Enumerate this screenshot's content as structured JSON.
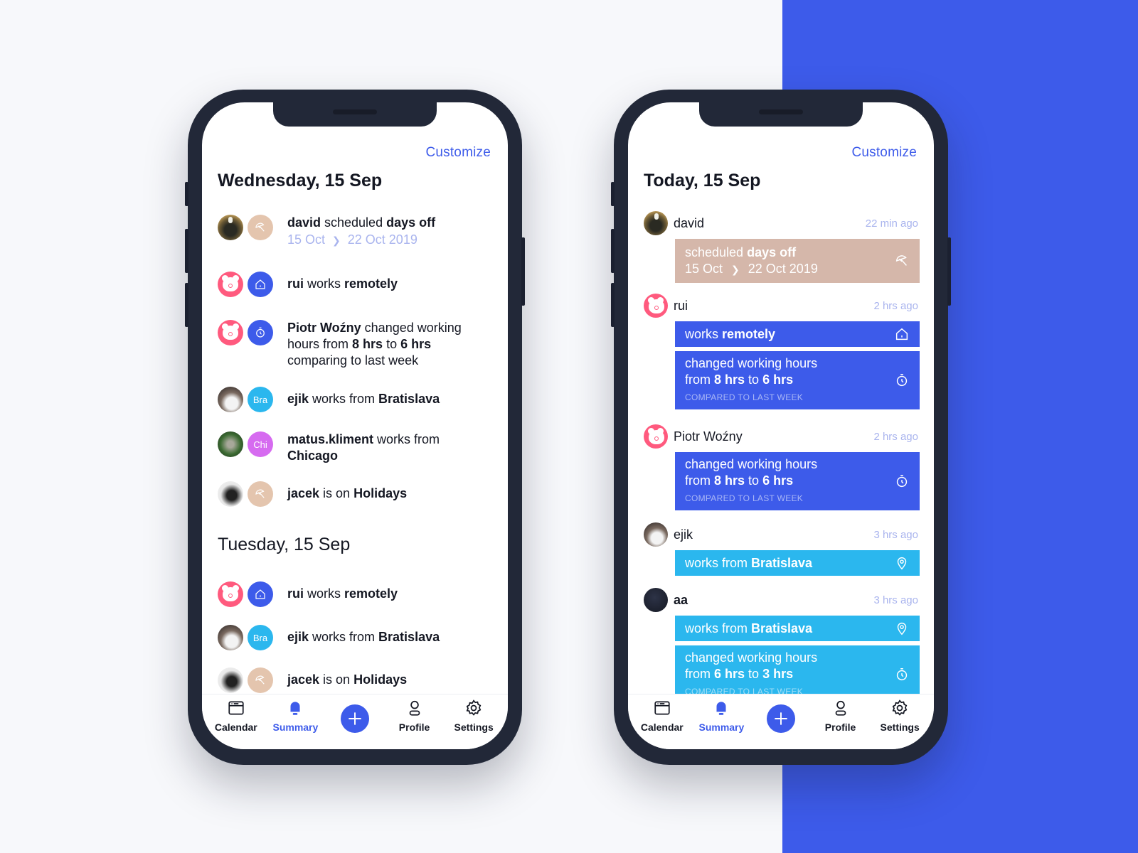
{
  "theme": {
    "accent": "#3d5bea",
    "cyan": "#2bb7ee",
    "beige": "#e4c5ae",
    "card_beige": "#d5b7aa",
    "purple": "#d66bf0",
    "pink": "#ff5a7e",
    "muted_blue": "#a9b4ee"
  },
  "left_phone": {
    "customize_label": "Customize",
    "sections": [
      {
        "title": "Wednesday, 15 Sep",
        "items": [
          {
            "user": "david",
            "badge_icon": "umbrella-icon",
            "parts": [
              "david",
              " scheduled ",
              "days off"
            ],
            "dates": {
              "from": "15 Oct",
              "to": "22 Oct 2019"
            }
          },
          {
            "user": "rui",
            "badge_icon": "home-icon",
            "parts": [
              "rui",
              " works ",
              "remotely"
            ]
          },
          {
            "user": "Piotr Woźny",
            "badge_icon": "stopwatch-icon",
            "parts": [
              "Piotr Woźny",
              " changed working hours from ",
              "8 hrs",
              " to ",
              "6 hrs",
              " comparing to last week"
            ]
          },
          {
            "user": "ejik",
            "badge_text": "Bra",
            "parts": [
              "ejik",
              " works from ",
              "Bratislava"
            ]
          },
          {
            "user": "matus.kliment",
            "badge_text": "Chi",
            "parts": [
              "matus.kliment",
              " works from ",
              "Chicago"
            ]
          },
          {
            "user": "jacek",
            "badge_icon": "umbrella-icon",
            "parts": [
              "jacek",
              " is on ",
              "Holidays"
            ]
          }
        ]
      },
      {
        "title": "Tuesday, 15 Sep",
        "items": [
          {
            "user": "rui",
            "badge_icon": "home-icon",
            "parts": [
              "rui",
              " works ",
              "remotely"
            ]
          },
          {
            "user": "ejik",
            "badge_text": "Bra",
            "parts": [
              "ejik",
              " works from ",
              "Bratislava"
            ]
          },
          {
            "user": "jacek",
            "badge_icon": "umbrella-icon",
            "parts": [
              "jacek",
              " is on ",
              "Holidays"
            ]
          }
        ]
      }
    ]
  },
  "right_phone": {
    "customize_label": "Customize",
    "title": "Today, 15 Sep",
    "entries": [
      {
        "user": "david",
        "time": "22 min ago",
        "cards": [
          {
            "color": "beige",
            "icon": "umbrella-icon",
            "parts": [
              "scheduled ",
              "days off"
            ],
            "dates": {
              "from": "15 Oct",
              "to": "22 Oct 2019"
            }
          }
        ]
      },
      {
        "user": "rui",
        "time": "2 hrs ago",
        "cards": [
          {
            "color": "blue",
            "icon": "home-icon",
            "parts": [
              "works ",
              "remotely"
            ]
          },
          {
            "color": "blue",
            "icon": "stopwatch-icon",
            "line1": "changed working hours",
            "parts": [
              "from ",
              "8 hrs",
              " to ",
              "6 hrs"
            ],
            "sub": "COMPARED TO LAST WEEK"
          }
        ]
      },
      {
        "user": "Piotr Woźny",
        "time": "2 hrs ago",
        "cards": [
          {
            "color": "blue",
            "icon": "stopwatch-icon",
            "line1": "changed working hours",
            "parts": [
              "from ",
              "8 hrs",
              " to ",
              "6 hrs"
            ],
            "sub": "COMPARED TO LAST WEEK"
          }
        ]
      },
      {
        "user": "ejik",
        "time": "3 hrs ago",
        "cards": [
          {
            "color": "cyan",
            "icon": "location-pin-icon",
            "parts": [
              "works from ",
              "Bratislava"
            ]
          }
        ]
      },
      {
        "user": "aa",
        "time": "3 hrs ago",
        "cards": [
          {
            "color": "cyan",
            "icon": "location-pin-icon",
            "parts": [
              "works from ",
              "Bratislava"
            ]
          },
          {
            "color": "cyan",
            "icon": "stopwatch-icon",
            "line1": "changed working hours",
            "parts": [
              "from ",
              "6 hrs",
              " to ",
              "3 hrs"
            ],
            "sub": "COMPARED TO LAST WEEK"
          }
        ]
      }
    ]
  },
  "tabbar": {
    "tabs": [
      {
        "label": "Calendar",
        "icon": "calendar-icon",
        "active": false
      },
      {
        "label": "Summary",
        "icon": "bell-icon",
        "active": true
      },
      {
        "label": "",
        "icon": "plus-icon",
        "active": false
      },
      {
        "label": "Profile",
        "icon": "profile-icon",
        "active": false
      },
      {
        "label": "Settings",
        "icon": "gear-icon",
        "active": false
      }
    ]
  }
}
